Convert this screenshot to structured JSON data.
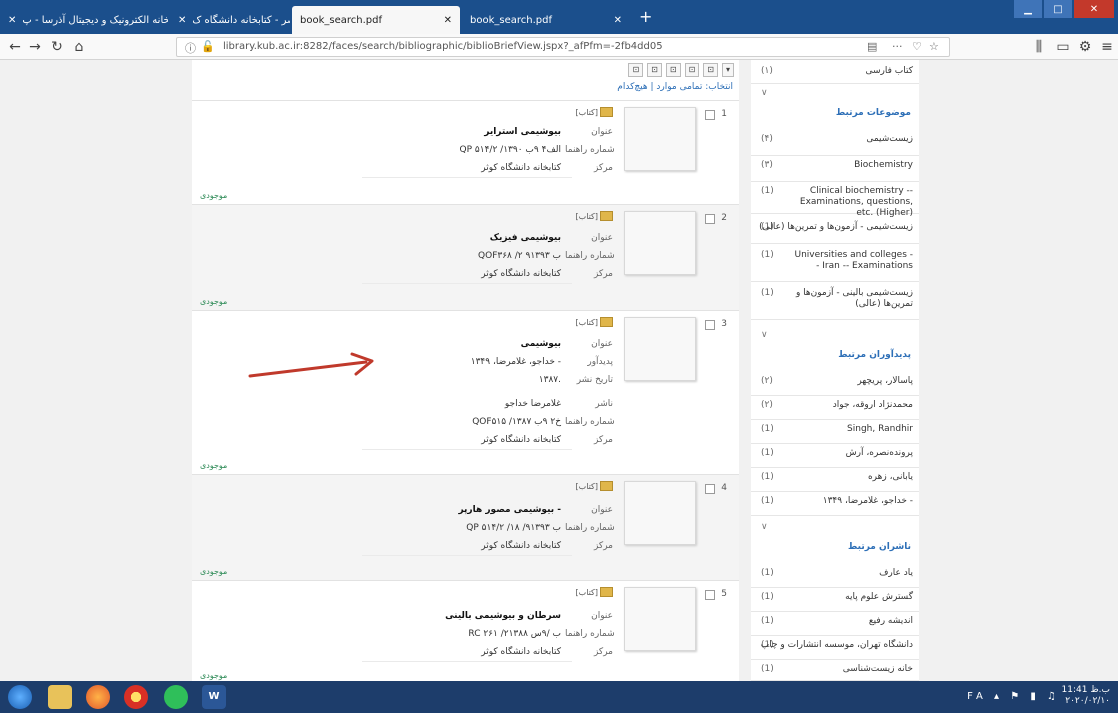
{
  "tabs": [
    {
      "label": "کتابخانه الکترونیک و دیجیتال آذرسا - پ"
    },
    {
      "label": "نمایش مختصر - کتابخانه دانشگاه ک"
    },
    {
      "label": "book_search.pdf"
    },
    {
      "label": "book_search.pdf"
    }
  ],
  "nav": {
    "url": "library.kub.ac.ir:8282/faces/search/bibliographic/biblioBriefView.jspx?_afPfm=-2fb4dd05"
  },
  "toolbar": {
    "select_line": "انتخاب: تمامی موارد | هیچ‌کدام"
  },
  "labels": {
    "title": "عنوان",
    "call_no": "شماره راهنما",
    "center": "مرکز",
    "creator": "پدیدآور",
    "pub_date": "تاریخ نشر",
    "publisher": "ناشر",
    "type_book": "[کتاب]",
    "available": "موجودی"
  },
  "records": [
    {
      "num": "1",
      "title": "بیوشیمی استرایر",
      "call_no": "QP ۵۱۴/۲ /الف۴ ۹ب ۱۳۹۰",
      "center": "کتابخانه دانشگاه کوثر"
    },
    {
      "num": "2",
      "title": "بیوشیمی فیزیک",
      "call_no": "QOF۳۶۸ /۲ ۹ب ۱۳۹۳",
      "center": "کتابخانه دانشگاه کوثر"
    },
    {
      "num": "3",
      "title": "بیوشیمی",
      "creator": "خداجو، غلامرضا، ۱۳۴۹ -",
      "pub_date": "۱۳۸۷.",
      "publisher": "غلامرضا خداجو",
      "call_no": "QOF۵۱۵ /خ۲ ۹ب ۱۳۸۷",
      "center": "کتابخانه دانشگاه کوثر"
    },
    {
      "num": "4",
      "title": "بیوشیمی مصور هارپر -",
      "call_no": "QP ۵۱۴/۲ /۱۸ /۹ب ۱۳۹۳",
      "center": "کتابخانه دانشگاه کوثر"
    },
    {
      "num": "5",
      "title": "سرطان و بیوشیمی بالینی",
      "call_no": "RC ۲۶۱ /۲ب /۹س ۱۳۸۸",
      "center": "کتابخانه دانشگاه کوثر"
    }
  ],
  "sidebar": {
    "top_item": {
      "count": "(۱)",
      "label": "کتاب فارسی"
    },
    "subjects_head": "موضوعات مرتبط",
    "subjects": [
      {
        "count": "(۴)",
        "label": "زیست‌شیمی"
      },
      {
        "count": "(۳)",
        "label": "Biochemistry"
      },
      {
        "count": "(1)",
        "label": "Clinical biochemistry -- Examinations, questions, etc. (Higher)"
      },
      {
        "count": "(1)",
        "label": "زیست‌شیمی - آزمون‌ها و تمرین‌ها (عالی)"
      },
      {
        "count": "(1)",
        "label": "Universities and colleges -- Iran -- Examinations"
      },
      {
        "count": "(1)",
        "label": "زیست‌شیمی بالینی - آزمون‌ها و تمرین‌ها (عالی)"
      }
    ],
    "authors_head": "پدیدآوران مرتبط",
    "authors": [
      {
        "count": "(۲)",
        "label": "پاسالار، پریچهر"
      },
      {
        "count": "(۲)",
        "label": "محمدنژاد اروقه، جواد"
      },
      {
        "count": "(1)",
        "label": "Singh, Randhir"
      },
      {
        "count": "(1)",
        "label": "پرونده‌نصره، آرش"
      },
      {
        "count": "(1)",
        "label": "یابانی، زهره"
      },
      {
        "count": "(1)",
        "label": "خداجو، غلامرضا، ۱۳۴۹ -"
      }
    ],
    "publishers_head": "ناشران مرتبط",
    "publishers": [
      {
        "count": "(1)",
        "label": "یاد عارف"
      },
      {
        "count": "(1)",
        "label": "گسترش علوم پایه"
      },
      {
        "count": "(1)",
        "label": "اندیشه رفیع"
      },
      {
        "count": "(1)",
        "label": "دانشگاه تهران، موسسه انتشارات و چاپ"
      },
      {
        "count": "(1)",
        "label": "خانه زیست‌شناسی"
      }
    ]
  },
  "taskbar": {
    "lang": "FA",
    "time": "11:41 ب.ظ",
    "date": "۲۰۲۰/۰۲/۱۰"
  },
  "colors": {
    "arrow": "#c0392b",
    "tab_bar": "#1b4f8c",
    "taskbar": "#1d3d6b"
  }
}
